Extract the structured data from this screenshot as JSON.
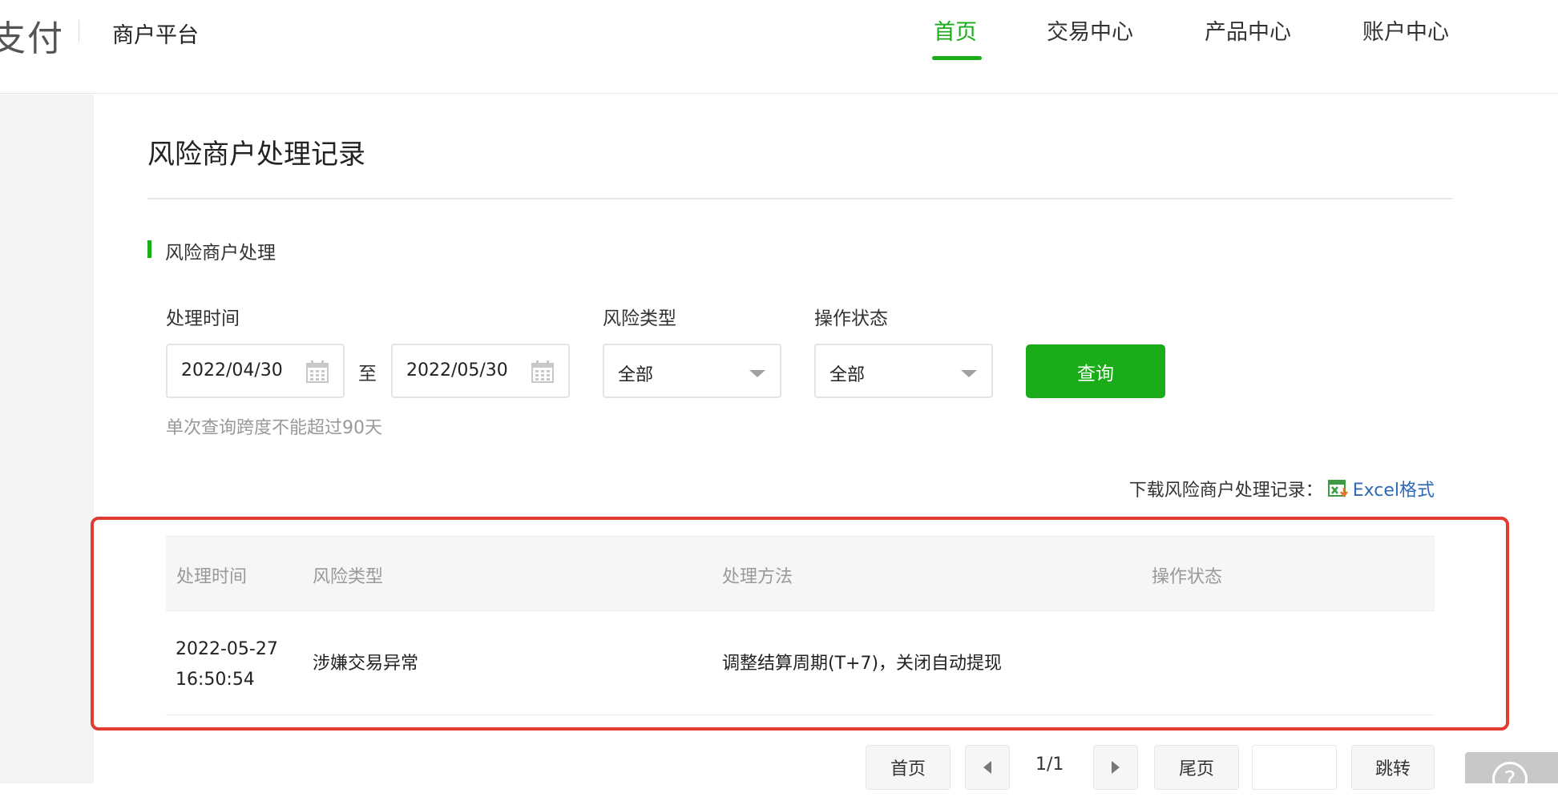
{
  "header": {
    "brand": "支付",
    "platform": "商户平台",
    "nav": [
      {
        "label": "首页",
        "active": true
      },
      {
        "label": "交易中心",
        "active": false
      },
      {
        "label": "产品中心",
        "active": false
      },
      {
        "label": "账户中心",
        "active": false
      }
    ]
  },
  "page": {
    "title": "风险商户处理记录",
    "section_title": "风险商户处理"
  },
  "filters": {
    "time_label": "处理时间",
    "start_date": "2022/04/30",
    "range_separator": "至",
    "end_date": "2022/05/30",
    "risk_type_label": "风险类型",
    "risk_type_value": "全部",
    "status_label": "操作状态",
    "status_value": "全部",
    "query_button": "查询",
    "hint": "单次查询跨度不能超过90天"
  },
  "download": {
    "label": "下载风险商户处理记录：",
    "link": "Excel格式"
  },
  "table": {
    "columns": [
      "处理时间",
      "风险类型",
      "处理方法",
      "操作状态"
    ],
    "rows": [
      {
        "time_date": "2022-05-27",
        "time_clock": "16:50:54",
        "risk_type": "涉嫌交易异常",
        "method": "调整结算周期(T+7)，关闭自动提现",
        "status": ""
      }
    ]
  },
  "pagination": {
    "first": "首页",
    "info": "1/1",
    "last": "尾页",
    "jump": "跳转",
    "jump_value": ""
  },
  "colors": {
    "accent": "#1aad19",
    "highlight": "#e03c31",
    "link": "#2e6ab8"
  }
}
